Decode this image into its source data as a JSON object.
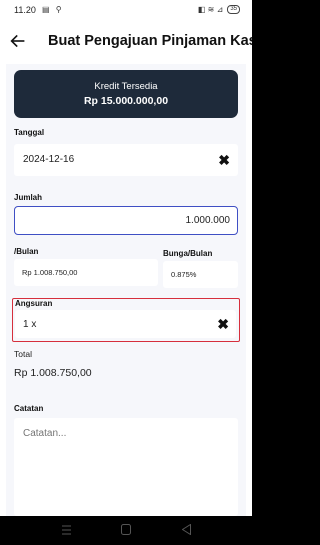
{
  "status_bar": {
    "time": "11.20",
    "left_icons": "▤ ⚲",
    "right_icons": "◧ ≋ ⊿",
    "battery": "35"
  },
  "header": {
    "back_icon": "arrow-left-icon",
    "title": "Buat Pengajuan Pinjaman Kas"
  },
  "credit": {
    "label": "Kredit Tersedia",
    "value": "Rp 15.000.000,00"
  },
  "form": {
    "tanggal": {
      "label": "Tanggal",
      "value": "2024-12-16"
    },
    "jumlah": {
      "label": "Jumlah",
      "value": "1.000.000"
    },
    "per_bulan": {
      "label": "/Bulan",
      "value": "Rp 1.008.750,00"
    },
    "bunga": {
      "label": "Bunga/Bulan",
      "value": "0.875%"
    },
    "angsuran": {
      "label": "Angsuran",
      "value": "1 x"
    },
    "total": {
      "label": "Total",
      "value": "Rp 1.008.750,00"
    },
    "catatan": {
      "label": "Catatan",
      "placeholder": "Catatan..."
    }
  },
  "colors": {
    "card_bg": "#1e2a3a",
    "focus_border": "#3f4fc4",
    "error_border": "#d62f3c",
    "panel_bg": "#f6f7fb"
  },
  "nav": {
    "recent_icon": "menu-lines-icon",
    "home_icon": "square-icon",
    "back_icon": "triangle-back-icon"
  }
}
